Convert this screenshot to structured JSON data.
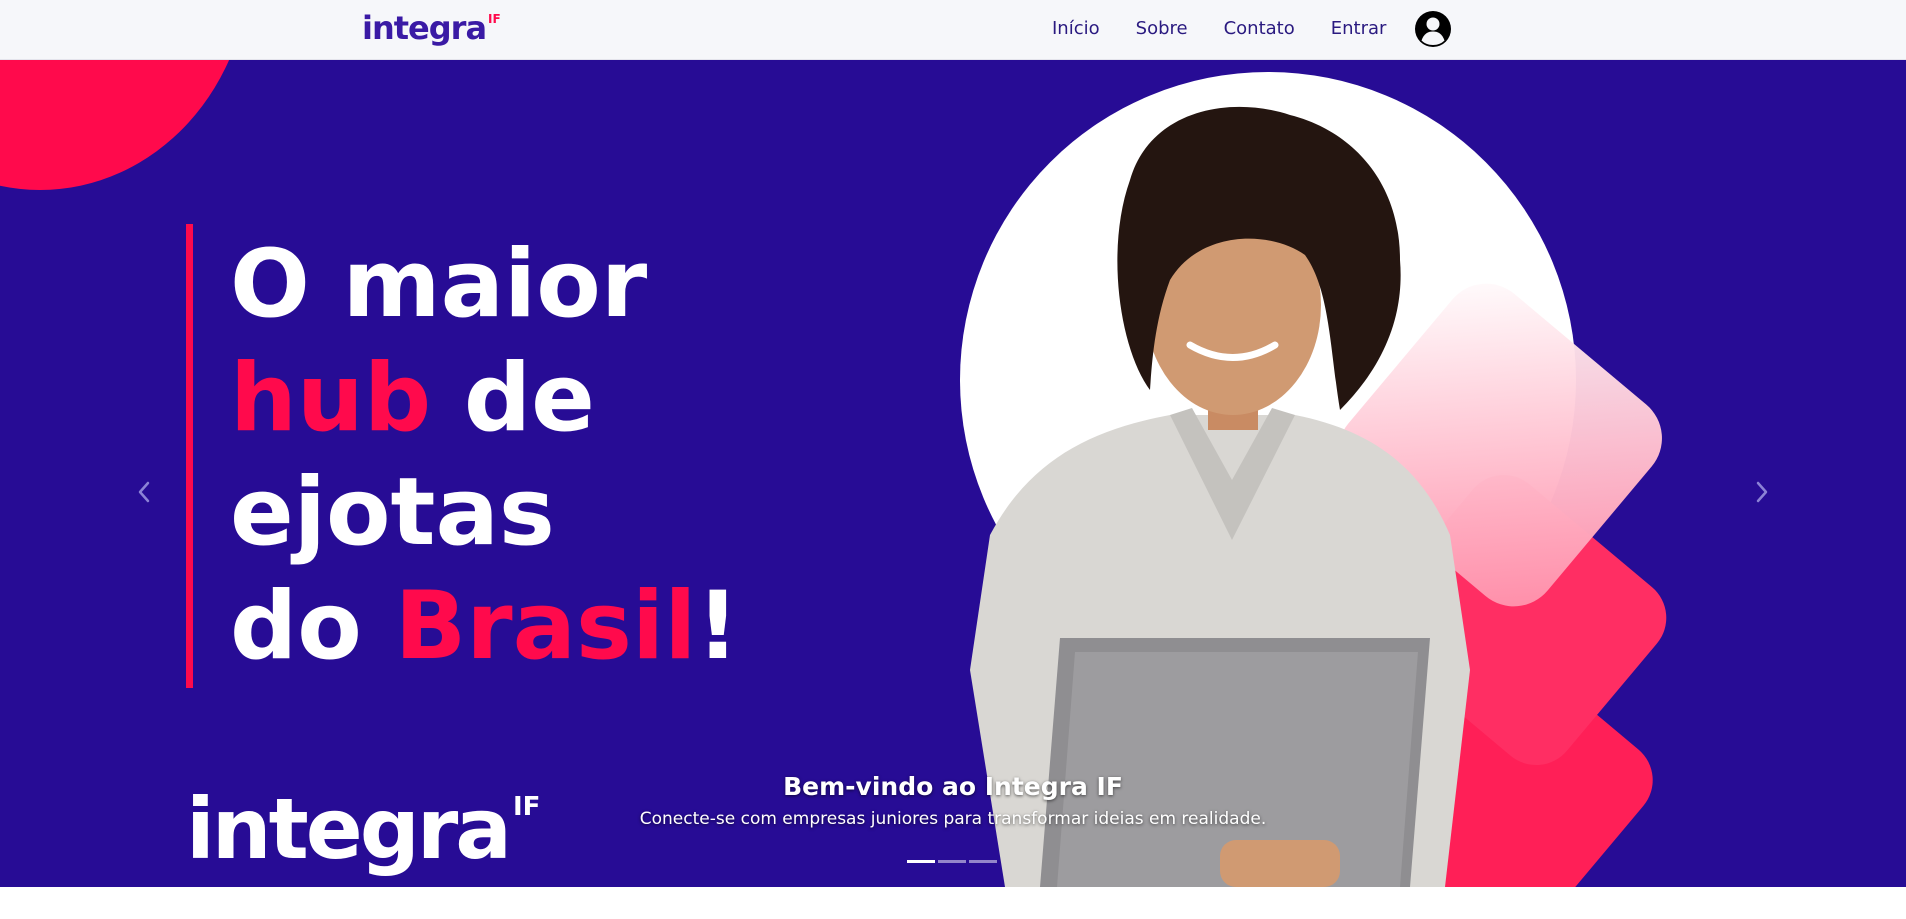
{
  "navbar": {
    "brand_word": "integra",
    "brand_superscript": "IF",
    "links": [
      "Início",
      "Sobre",
      "Contato",
      "Entrar"
    ],
    "account_icon": "user-circle-icon"
  },
  "hero": {
    "headline": {
      "line1": "O maior",
      "line2_accent": "hub",
      "line2_rest": " de",
      "line3": "ejotas",
      "line4_start": "do ",
      "line4_accent": "Brasil",
      "line4_end": "!"
    },
    "logo_word": "integra",
    "logo_superscript": "IF",
    "caption_title": "Bem-vindo ao Integra IF",
    "caption_text": "Conecte-se com empresas juniores para transformar ideias em realidade.",
    "prev_icon": "chevron-left-icon",
    "next_icon": "chevron-right-icon",
    "slides_count": 3,
    "active_slide": 1
  },
  "colors": {
    "hero_background": "#270c95",
    "accent": "#ff0a4c",
    "brand_purple": "#3a1aa5",
    "nav_text": "#2a1a80",
    "navbar_background": "#f6f7fa"
  }
}
